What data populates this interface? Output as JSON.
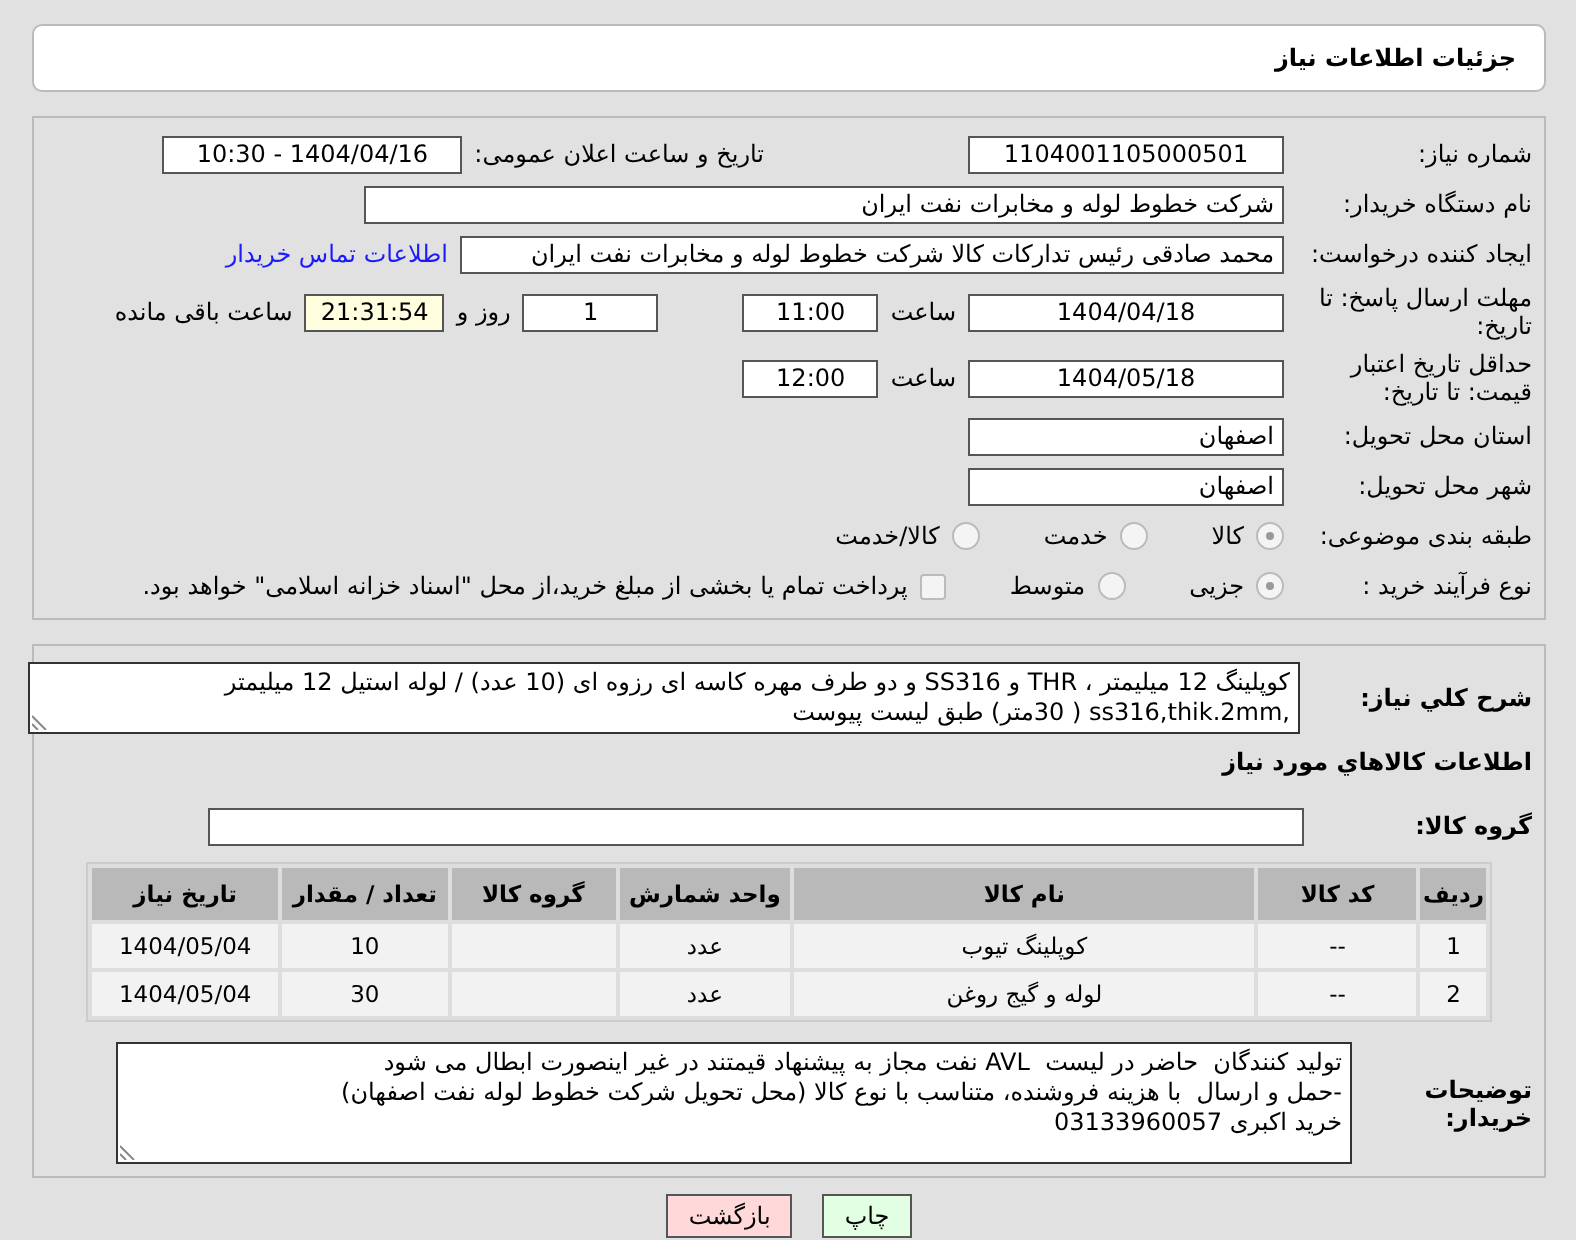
{
  "header": {
    "title": "جزئیات اطلاعات نیاز"
  },
  "need_number": {
    "label": "شماره نیاز:",
    "value": "1104001105000501"
  },
  "announce": {
    "label": "تاریخ و ساعت اعلان عمومی:",
    "value": "1404/04/16 - 10:30"
  },
  "buyer": {
    "label": "نام دستگاه خریدار:",
    "value": "شرکت خطوط لوله و مخابرات نفت ایران"
  },
  "creator": {
    "label": "ایجاد کننده درخواست:",
    "value": "محمد صادقی رئیس تدارکات کالا  شرکت خطوط لوله و مخابرات نفت ایران",
    "link": "اطلاعات تماس خریدار"
  },
  "reply_deadline": {
    "label": "مهلت ارسال پاسخ: تا تاریخ:",
    "date": "1404/04/18",
    "time_label": "ساعت",
    "time": "11:00",
    "days": "1",
    "days_label": "روز و",
    "remaining": "21:31:54",
    "remaining_label": "ساعت باقی مانده"
  },
  "price_validity": {
    "label": "حداقل تاریخ اعتبار قیمت: تا تاریخ:",
    "date": "1404/05/18",
    "time_label": "ساعت",
    "time": "12:00"
  },
  "province": {
    "label": "استان محل تحویل:",
    "value": "اصفهان"
  },
  "city": {
    "label": "شهر محل تحویل:",
    "value": "اصفهان"
  },
  "category": {
    "label": "طبقه بندی موضوعی:",
    "options": [
      {
        "label": "کالا",
        "selected": true
      },
      {
        "label": "خدمت",
        "selected": false
      },
      {
        "label": "کالا/خدمت",
        "selected": false
      }
    ]
  },
  "process": {
    "label": "نوع فرآیند خرید :",
    "options": [
      {
        "label": "جزیی",
        "selected": true
      },
      {
        "label": "متوسط",
        "selected": false
      }
    ],
    "payment": {
      "label": "پرداخت تمام یا بخشی از مبلغ خرید،از محل \"اسناد خزانه اسلامی\" خواهد بود.",
      "checked": false
    }
  },
  "summary": {
    "label": "شرح کلي نياز:",
    "value": "کوپلینگ 12 میلیمتر ، THR و SS316 و دو طرف مهره کاسه ای رزوه ای (10 عدد) / لوله استیل 12 میلیمتر ,ss316,thik.2mm ( 30متر) طبق لیست پیوست"
  },
  "goods_title": "اطلاعات کالاهاي مورد نياز",
  "goods_group": {
    "label": "گروه کالا:"
  },
  "table": {
    "columns": [
      "ردیف",
      "کد کالا",
      "نام کالا",
      "واحد شمارش",
      "گروه کالا",
      "تعداد / مقدار",
      "تاریخ نیاز"
    ],
    "rows": [
      [
        "1",
        "--",
        "کوپلینگ تیوب",
        "عدد",
        "",
        "10",
        "1404/05/04"
      ],
      [
        "2",
        "--",
        "لوله و گیج روغن",
        "عدد",
        "",
        "30",
        "1404/05/04"
      ]
    ]
  },
  "notes": {
    "label": "توضیحات خریدار:",
    "lines": [
      "تولید کنندگان  حاضر در لیست  AVL نفت مجاز به پیشنهاد قیمتند در غیر اینصورت ابطال می شود",
      "-حمل و ارسال  با هزینه فروشنده، متناسب با نوع کالا (محل تحویل شرکت خطوط لوله نفت اصفهان)",
      "خرید اکبری 03133960057"
    ]
  },
  "buttons": [
    {
      "kind": "print",
      "label": "چاپ"
    },
    {
      "kind": "back",
      "label": "بازگشت"
    }
  ]
}
